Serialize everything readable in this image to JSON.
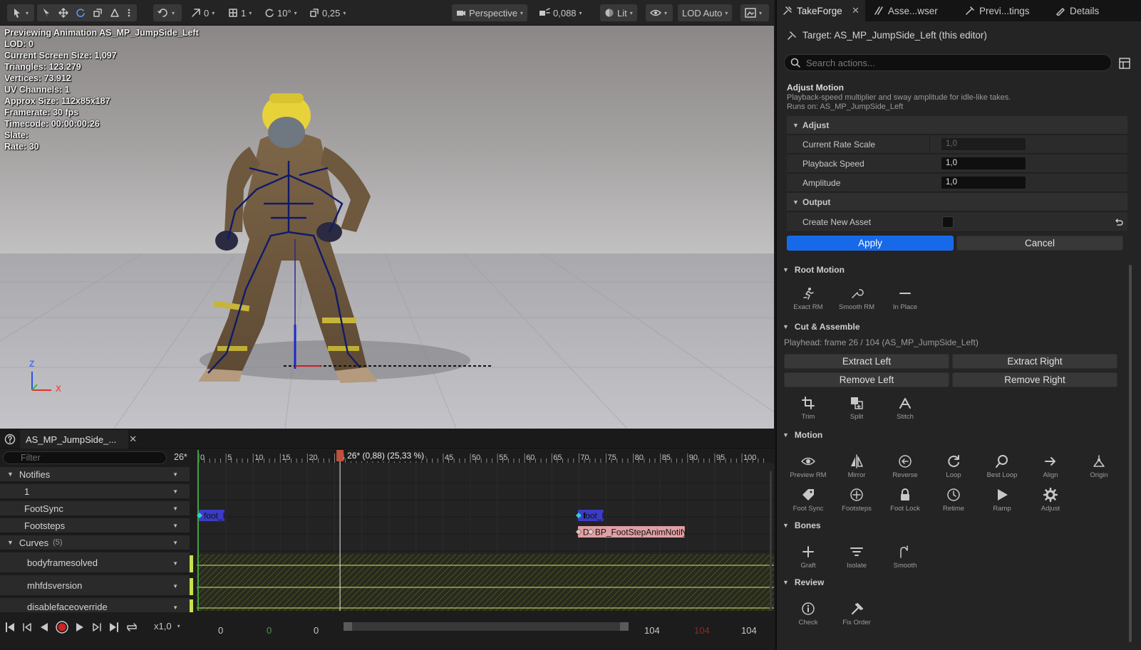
{
  "viewport": {
    "toolbar": {
      "grid_snap": "0",
      "grid_num": "1",
      "rot_snap": "10°",
      "scale_snap": "0,25",
      "view_mode": "Perspective",
      "cam_speed": "0,088",
      "lighting": "Lit",
      "lod": "LOD Auto"
    },
    "stats": [
      "Previewing Animation AS_MP_JumpSide_Left",
      "LOD: 0",
      "Current Screen Size: 1,097",
      "Triangles: 123.279",
      "Vertices: 73.912",
      "UV Channels: 1",
      "Approx Size: 112x85x187",
      "Framerate: 30 fps",
      "Timecode: 00:00:00:26",
      "Slate:",
      "Rate: 30"
    ],
    "axis": {
      "z": "Z",
      "x": "X"
    }
  },
  "right_panel": {
    "tabs": [
      "TakeForge",
      "Asse...wser",
      "Previ...tings",
      "Details"
    ],
    "target": "Target: AS_MP_JumpSide_Left (this editor)",
    "search_placeholder": "Search actions...",
    "adjust_motion": {
      "title": "Adjust Motion",
      "desc": "Playback-speed multiplier and sway amplitude for idle-like takes.",
      "runs_on": "Runs on: AS_MP_JumpSide_Left",
      "adjust_header": "Adjust",
      "rows": [
        {
          "label": "Current Rate Scale",
          "value": "1,0"
        },
        {
          "label": "Playback Speed",
          "value": "1,0"
        },
        {
          "label": "Amplitude",
          "value": "1,0"
        }
      ],
      "output_header": "Output",
      "create_new_asset": "Create New Asset",
      "apply": "Apply",
      "cancel": "Cancel"
    },
    "root_motion": {
      "header": "Root Motion",
      "tools": [
        "Exact RM",
        "Smooth RM",
        "In Place"
      ]
    },
    "cut_assemble": {
      "header": "Cut & Assemble",
      "playhead": "Playhead: frame 26 / 104  (AS_MP_JumpSide_Left)",
      "buttons": [
        "Extract Left",
        "Extract Right",
        "Remove Left",
        "Remove Right"
      ],
      "tools": [
        "Trim",
        "Split",
        "Stitch"
      ]
    },
    "motion": {
      "header": "Motion",
      "tools": [
        "Preview RM",
        "Mirror",
        "Reverse",
        "Loop",
        "Best Loop",
        "Align",
        "Origin",
        "Foot Sync",
        "Footsteps",
        "Foot Lock",
        "Retime",
        "Ramp",
        "Adjust"
      ]
    },
    "bones": {
      "header": "Bones",
      "tools": [
        "Graft",
        "Isolate",
        "Smooth"
      ]
    },
    "review": {
      "header": "Review",
      "tools": [
        "Check",
        "Fix Order"
      ]
    }
  },
  "sequencer": {
    "tab_label": "AS_MP_JumpSide_...",
    "filter_placeholder": "Filter",
    "frame": "26*",
    "tracks": {
      "notifies": "Notifies",
      "n1": "1",
      "footsync": "FootSync",
      "footsteps": "Footsteps",
      "curves": "Curves",
      "curves_count": "(5)",
      "curve_names": [
        "bodyframesolved",
        "mhfdsversion",
        "disablefaceoverride"
      ]
    },
    "ruler_ticks": [
      "0",
      "5",
      "10",
      "15",
      "20",
      "25",
      "30",
      "35",
      "40",
      "45",
      "50",
      "55",
      "60",
      "65",
      "70",
      "75",
      "80",
      "85",
      "90",
      "95",
      "100"
    ],
    "playhead_label": "26* (0,88) (25,33 %)",
    "playhead_frame": 26,
    "total_frames": 104,
    "notify_foot1": "foot_l",
    "notify_foot2": "foot_l",
    "notify_foot2_prefix": "f",
    "notify_fs_prefix": "D",
    "notify_bp": "BP_FootStepAnimNotify",
    "transport": {
      "speed": "x1,0",
      "left_vals": [
        "0",
        "0",
        "0"
      ],
      "right_vals": [
        "104",
        "104",
        "104"
      ]
    },
    "colors": {
      "notify_blue": "#3b3bc9",
      "notify_pink": "#e0a0a4",
      "curve_yellow": "#d8e070",
      "playhead_red": "#c0503c"
    }
  }
}
